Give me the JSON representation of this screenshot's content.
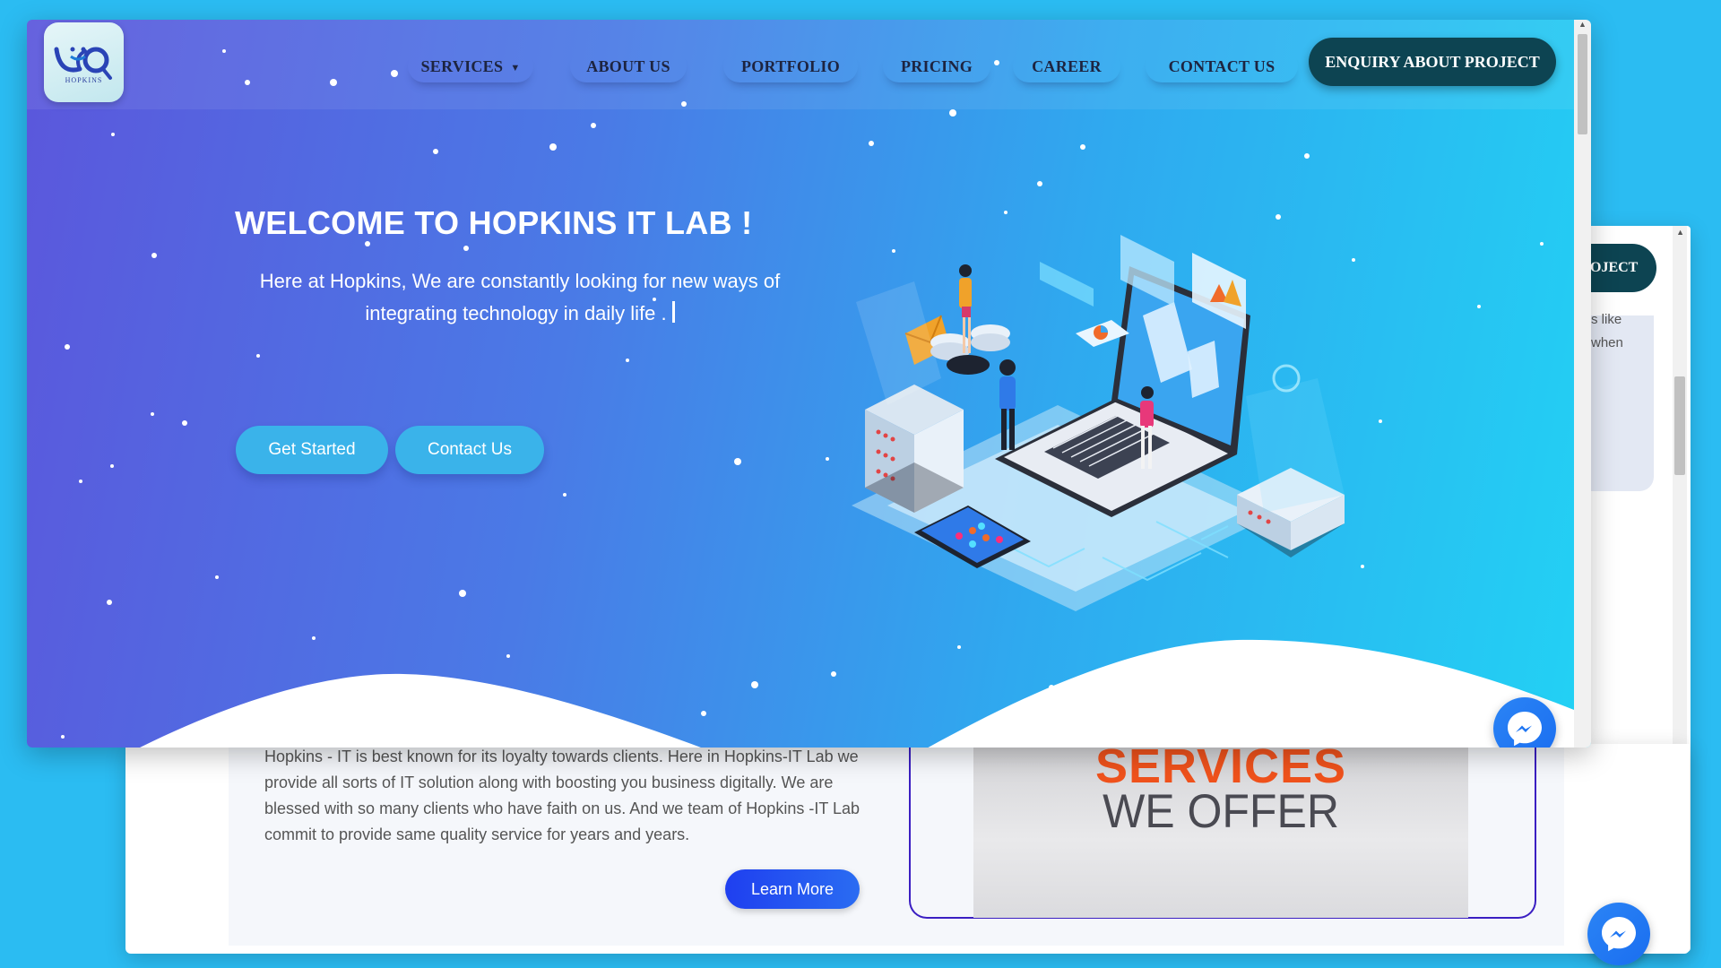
{
  "nav": {
    "logo_text": "HOPKINS",
    "items": [
      {
        "label": "SERVICES"
      },
      {
        "label": "ABOUT US"
      },
      {
        "label": "PORTFOLIO"
      },
      {
        "label": "PRICING"
      },
      {
        "label": "CAREER"
      },
      {
        "label": "CONTACT US"
      }
    ],
    "enquiry_label": "ENQUIRY ABOUT PROJECT"
  },
  "hero": {
    "title": "WELCOME TO HOPKINS IT LAB !",
    "subtitle": "Here at Hopkins, We are constantly looking for new ways of integrating technology in daily life .",
    "get_started": "Get Started",
    "contact_us": "Contact Us"
  },
  "about": {
    "text": "Hopkins - IT is best known for its loyalty towards clients. Here in Hopkins-IT Lab we provide all sorts of IT solution along with boosting you business digitally. We are blessed with so many clients who have faith on us. And we team of Hopkins -IT Lab commit to provide same quality service for years and years.",
    "learn_more": "Learn More"
  },
  "services_image": {
    "line1": "SERVICES",
    "line2": "WE OFFER"
  },
  "back_window": {
    "enquiry_partial": "OJECT",
    "text_partial": "s like\nwhen"
  },
  "colors": {
    "enquiry_bg": "#0d4452",
    "button_blue": "#3ab3ea",
    "learn_more_blue": "#1f3ff0",
    "page_bg": "#2bbcf2"
  },
  "icons": [
    "messenger-icon",
    "caret-down-icon",
    "logo-icon"
  ]
}
